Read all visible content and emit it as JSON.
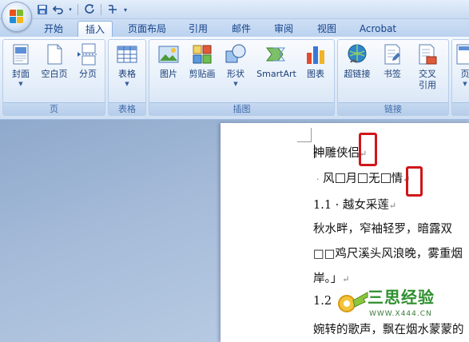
{
  "tabs": [
    {
      "label": "开始",
      "active": false
    },
    {
      "label": "插入",
      "active": true
    },
    {
      "label": "页面布局",
      "active": false
    },
    {
      "label": "引用",
      "active": false
    },
    {
      "label": "邮件",
      "active": false
    },
    {
      "label": "审阅",
      "active": false
    },
    {
      "label": "视图",
      "active": false
    },
    {
      "label": "Acrobat",
      "active": false
    }
  ],
  "ribbon": {
    "groups": [
      {
        "label": "页",
        "buttons": [
          {
            "label": "封面",
            "icon": "cover-page-icon"
          },
          {
            "label": "空白页",
            "icon": "blank-page-icon"
          },
          {
            "label": "分页",
            "icon": "page-break-icon"
          }
        ]
      },
      {
        "label": "表格",
        "buttons": [
          {
            "label": "表格",
            "icon": "table-icon"
          }
        ]
      },
      {
        "label": "插图",
        "buttons": [
          {
            "label": "图片",
            "icon": "picture-icon"
          },
          {
            "label": "剪贴画",
            "icon": "clip-art-icon"
          },
          {
            "label": "形状",
            "icon": "shapes-icon"
          },
          {
            "label": "SmartArt",
            "icon": "smartart-icon"
          },
          {
            "label": "图表",
            "icon": "chart-icon"
          }
        ]
      },
      {
        "label": "链接",
        "buttons": [
          {
            "label": "超链接",
            "icon": "hyperlink-icon"
          },
          {
            "label": "书签",
            "icon": "bookmark-icon"
          },
          {
            "label": "交叉",
            "label2": "引用",
            "icon": "cross-reference-icon"
          }
        ]
      },
      {
        "label": "",
        "buttons": [
          {
            "label": "页",
            "icon": "header-icon"
          }
        ]
      }
    ]
  },
  "document": {
    "lines": [
      {
        "text": "神雕侠侣",
        "mark": "↵"
      },
      {
        "parts": [
          "风",
          "月",
          "无",
          "情"
        ],
        "mark": "↵"
      },
      {
        "text": "1.1 · 越女采莲",
        "mark": "↵"
      },
      {
        "text": "秋水畔，窄袖轻罗，暗露双"
      },
      {
        "text": "□□鸡尺溪头风浪晚，雾重烟"
      },
      {
        "text": "岸。」",
        "mark": "↵"
      },
      {
        "text": "1.2"
      },
      {
        "text": "婉转的歌声，飘在烟水蒙蒙的"
      }
    ]
  },
  "watermark": {
    "title": "三思经验",
    "url": "WWW.X444.CN"
  },
  "colors": {
    "accent": "#15428b",
    "highlight": "#d0161a"
  }
}
